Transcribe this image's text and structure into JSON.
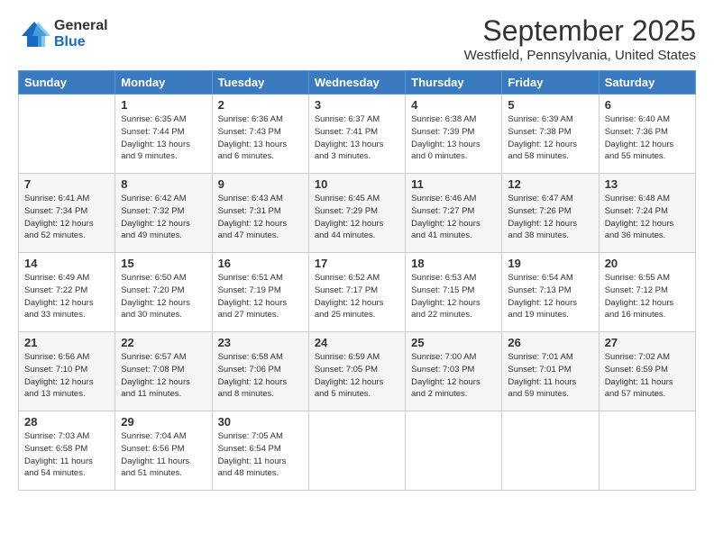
{
  "header": {
    "logo_general": "General",
    "logo_blue": "Blue",
    "month_title": "September 2025",
    "location": "Westfield, Pennsylvania, United States"
  },
  "weekdays": [
    "Sunday",
    "Monday",
    "Tuesday",
    "Wednesday",
    "Thursday",
    "Friday",
    "Saturday"
  ],
  "weeks": [
    [
      {
        "day": "",
        "info": ""
      },
      {
        "day": "1",
        "info": "Sunrise: 6:35 AM\nSunset: 7:44 PM\nDaylight: 13 hours\nand 9 minutes."
      },
      {
        "day": "2",
        "info": "Sunrise: 6:36 AM\nSunset: 7:43 PM\nDaylight: 13 hours\nand 6 minutes."
      },
      {
        "day": "3",
        "info": "Sunrise: 6:37 AM\nSunset: 7:41 PM\nDaylight: 13 hours\nand 3 minutes."
      },
      {
        "day": "4",
        "info": "Sunrise: 6:38 AM\nSunset: 7:39 PM\nDaylight: 13 hours\nand 0 minutes."
      },
      {
        "day": "5",
        "info": "Sunrise: 6:39 AM\nSunset: 7:38 PM\nDaylight: 12 hours\nand 58 minutes."
      },
      {
        "day": "6",
        "info": "Sunrise: 6:40 AM\nSunset: 7:36 PM\nDaylight: 12 hours\nand 55 minutes."
      }
    ],
    [
      {
        "day": "7",
        "info": "Sunrise: 6:41 AM\nSunset: 7:34 PM\nDaylight: 12 hours\nand 52 minutes."
      },
      {
        "day": "8",
        "info": "Sunrise: 6:42 AM\nSunset: 7:32 PM\nDaylight: 12 hours\nand 49 minutes."
      },
      {
        "day": "9",
        "info": "Sunrise: 6:43 AM\nSunset: 7:31 PM\nDaylight: 12 hours\nand 47 minutes."
      },
      {
        "day": "10",
        "info": "Sunrise: 6:45 AM\nSunset: 7:29 PM\nDaylight: 12 hours\nand 44 minutes."
      },
      {
        "day": "11",
        "info": "Sunrise: 6:46 AM\nSunset: 7:27 PM\nDaylight: 12 hours\nand 41 minutes."
      },
      {
        "day": "12",
        "info": "Sunrise: 6:47 AM\nSunset: 7:26 PM\nDaylight: 12 hours\nand 38 minutes."
      },
      {
        "day": "13",
        "info": "Sunrise: 6:48 AM\nSunset: 7:24 PM\nDaylight: 12 hours\nand 36 minutes."
      }
    ],
    [
      {
        "day": "14",
        "info": "Sunrise: 6:49 AM\nSunset: 7:22 PM\nDaylight: 12 hours\nand 33 minutes."
      },
      {
        "day": "15",
        "info": "Sunrise: 6:50 AM\nSunset: 7:20 PM\nDaylight: 12 hours\nand 30 minutes."
      },
      {
        "day": "16",
        "info": "Sunrise: 6:51 AM\nSunset: 7:19 PM\nDaylight: 12 hours\nand 27 minutes."
      },
      {
        "day": "17",
        "info": "Sunrise: 6:52 AM\nSunset: 7:17 PM\nDaylight: 12 hours\nand 25 minutes."
      },
      {
        "day": "18",
        "info": "Sunrise: 6:53 AM\nSunset: 7:15 PM\nDaylight: 12 hours\nand 22 minutes."
      },
      {
        "day": "19",
        "info": "Sunrise: 6:54 AM\nSunset: 7:13 PM\nDaylight: 12 hours\nand 19 minutes."
      },
      {
        "day": "20",
        "info": "Sunrise: 6:55 AM\nSunset: 7:12 PM\nDaylight: 12 hours\nand 16 minutes."
      }
    ],
    [
      {
        "day": "21",
        "info": "Sunrise: 6:56 AM\nSunset: 7:10 PM\nDaylight: 12 hours\nand 13 minutes."
      },
      {
        "day": "22",
        "info": "Sunrise: 6:57 AM\nSunset: 7:08 PM\nDaylight: 12 hours\nand 11 minutes."
      },
      {
        "day": "23",
        "info": "Sunrise: 6:58 AM\nSunset: 7:06 PM\nDaylight: 12 hours\nand 8 minutes."
      },
      {
        "day": "24",
        "info": "Sunrise: 6:59 AM\nSunset: 7:05 PM\nDaylight: 12 hours\nand 5 minutes."
      },
      {
        "day": "25",
        "info": "Sunrise: 7:00 AM\nSunset: 7:03 PM\nDaylight: 12 hours\nand 2 minutes."
      },
      {
        "day": "26",
        "info": "Sunrise: 7:01 AM\nSunset: 7:01 PM\nDaylight: 11 hours\nand 59 minutes."
      },
      {
        "day": "27",
        "info": "Sunrise: 7:02 AM\nSunset: 6:59 PM\nDaylight: 11 hours\nand 57 minutes."
      }
    ],
    [
      {
        "day": "28",
        "info": "Sunrise: 7:03 AM\nSunset: 6:58 PM\nDaylight: 11 hours\nand 54 minutes."
      },
      {
        "day": "29",
        "info": "Sunrise: 7:04 AM\nSunset: 6:56 PM\nDaylight: 11 hours\nand 51 minutes."
      },
      {
        "day": "30",
        "info": "Sunrise: 7:05 AM\nSunset: 6:54 PM\nDaylight: 11 hours\nand 48 minutes."
      },
      {
        "day": "",
        "info": ""
      },
      {
        "day": "",
        "info": ""
      },
      {
        "day": "",
        "info": ""
      },
      {
        "day": "",
        "info": ""
      }
    ]
  ]
}
